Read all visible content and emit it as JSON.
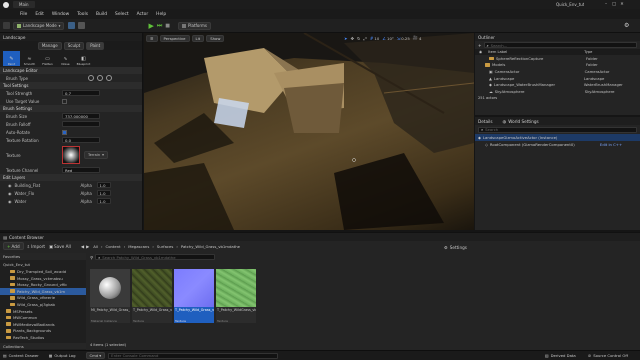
{
  "window": {
    "project_tab": "Quick_Env_tut",
    "level_tab": "Main"
  },
  "menu": [
    "File",
    "Edit",
    "Window",
    "Tools",
    "Build",
    "Select",
    "Actor",
    "Help"
  ],
  "toolbar": {
    "mode_label": "Landscape Mode",
    "platforms_label": "Platforms"
  },
  "landscape_panel": {
    "tab": "Landscape",
    "modes": [
      "Manage",
      "Sculpt",
      "Paint"
    ],
    "tools": [
      "Paint",
      "Smooth",
      "Flatten",
      "Noise",
      "Blueprint"
    ],
    "sections": {
      "editor": "Landscape Editor",
      "brush_type_label": "Brush Type",
      "tool_settings": "Tool Settings",
      "tool_strength_label": "Tool Strength",
      "tool_strength_value": "0.7",
      "use_target_value_label": "Use Target Value",
      "brush_settings": "Brush Settings",
      "brush_size_label": "Brush Size",
      "brush_size_value": "737.000000",
      "brush_falloff_label": "Brush Falloff",
      "auto_rotate_label": "Auto-Rotate",
      "texture_rotation_label": "Texture Rotation",
      "texture_rotation_value": "0.0",
      "texture_label": "Texture",
      "texture_dropdown": "Terrain",
      "texture_channel_label": "Texture Channel",
      "texture_channel_value": "Red",
      "edit_layers": "Edit Layers"
    },
    "layers": [
      {
        "name": "Building_Flat",
        "alpha_label": "Alpha",
        "alpha": "1.0"
      },
      {
        "name": "Water_Flo",
        "alpha_label": "Alpha",
        "alpha": "1.0"
      },
      {
        "name": "Water",
        "alpha_label": "Alpha",
        "alpha": "1.0"
      }
    ]
  },
  "viewport": {
    "perspective": "Perspective",
    "lit": "Lit",
    "show": "Show",
    "grid_value": "10",
    "angle_value": "10°",
    "scale_value": "0.25",
    "camera_speed": "4"
  },
  "outliner": {
    "tab": "Outliner",
    "search_placeholder": "Search...",
    "col_label": "Item Label",
    "col_type": "Type",
    "rows": [
      {
        "label": "SphereReflectionCapture",
        "type": "Folder"
      },
      {
        "label": "Models",
        "type": "Folder"
      },
      {
        "label": "CameraActor",
        "type": "CameraActor"
      },
      {
        "label": "Landscape",
        "type": "Landscape"
      },
      {
        "label": "Landscape_WaterBrushManager",
        "type": "WaterBrushManager"
      },
      {
        "label": "SkyAtmosphere",
        "type": "SkyAtmosphere"
      }
    ],
    "actor_count": "251 actors"
  },
  "details": {
    "tab": "Details",
    "world_settings_tab": "World Settings",
    "search_placeholder": "Search",
    "selected_actor": "LandscapeGizmoActiveActor (Instance)",
    "component": "RootComponent (GizmoRenderComponent0)",
    "edit_link": "Edit in C++"
  },
  "content_browser": {
    "tab": "Content Browser",
    "add_label": "Add",
    "import_label": "Import",
    "save_all_label": "Save All",
    "breadcrumb": [
      "All",
      "Content",
      "Megascans",
      "Surfaces",
      "Patchy_Wild_Grass_vb1mdathe"
    ],
    "settings_label": "Settings",
    "favorites_label": "Favorites",
    "root_label": "Quick_Env_tut",
    "search_placeholder": "Search Patchy_Wild_Grass_vb1mdathe",
    "folders": [
      "Dry_Trampled_Soil_wcadd",
      "Mossy_Grass_vckmabsu",
      "Mossy_Rocky_Ground_vfib",
      "Patchy_Wild_Grass_vb1m",
      "Wild_Grass_vfkeerie",
      "Wild_Grass_pj3gkab",
      "MSPresets",
      "MWCommon",
      "MWMedievalBadlands",
      "Plants_Backgrounds",
      "RezTech_Studios"
    ],
    "assets": [
      {
        "name": "MI_Patchy_Wild_Grass_vb1mdathe_4K",
        "kind": "Material Instance"
      },
      {
        "name": "T_Patchy_Wild_Grass_vb1mdathe_4K_D",
        "kind": "Texture"
      },
      {
        "name": "T_Patchy_Wild_Grass_vb1mdathe_4K_N",
        "kind": "Texture"
      },
      {
        "name": "T_Patchy_WildGrass_vb1mdathe_4K_ORD",
        "kind": "Texture"
      }
    ],
    "item_count": "4 items (1 selected)",
    "collections_label": "Collections"
  },
  "statusbar": {
    "content_drawer": "Content Drawer",
    "output_log": "Output Log",
    "cmd": "Cmd",
    "console_placeholder": "Enter Console Command",
    "derived_data": "Derived Data",
    "source_control": "Source Control Off"
  }
}
